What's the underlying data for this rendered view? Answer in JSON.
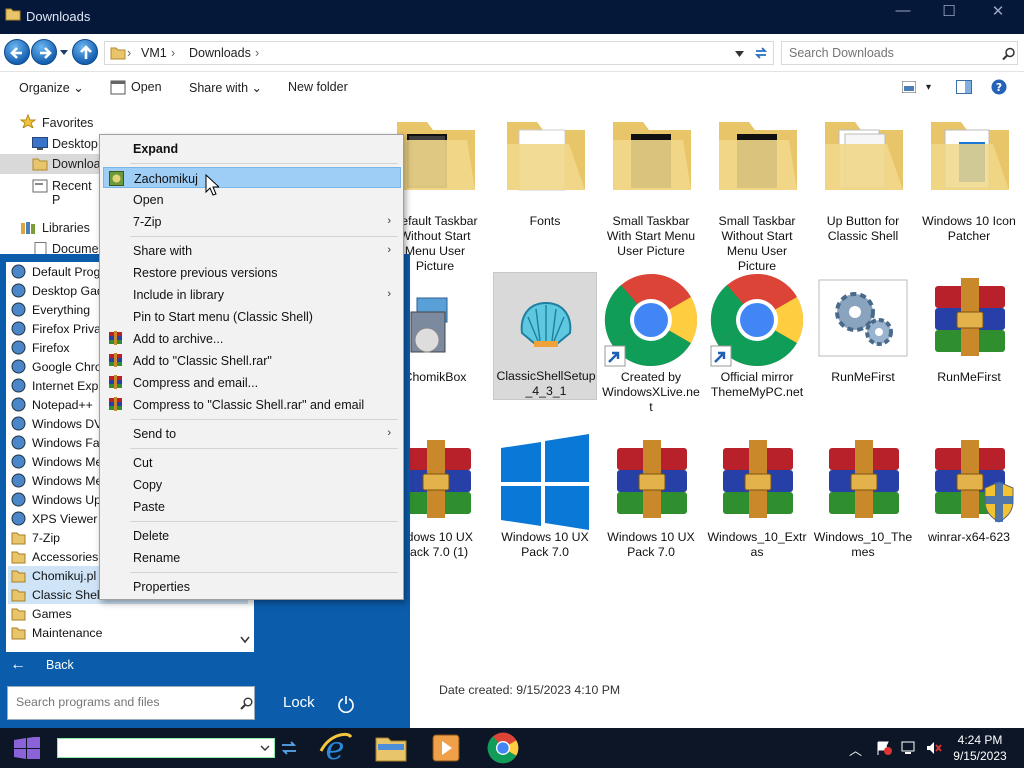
{
  "window": {
    "title": "Downloads",
    "controls": [
      "minimize",
      "maximize",
      "close"
    ]
  },
  "address": {
    "crumbs": [
      "VM1",
      "Downloads"
    ],
    "search_placeholder": "Search Downloads"
  },
  "toolbar": {
    "organize": "Organize",
    "open": "Open",
    "share_with": "Share with",
    "new_folder": "New folder"
  },
  "nav": {
    "favorites": "Favorites",
    "desktop": "Desktop",
    "downloads": "Downloa",
    "recent": "Recent P",
    "libraries": "Libraries",
    "documents": "Docume"
  },
  "files": {
    "row1": [
      {
        "label": "Default Taskbar\nWithout Start\nMenu User\nPicture",
        "icon": "folder-dark-icon"
      },
      {
        "label": "Fonts",
        "icon": "folder-doc-icon"
      },
      {
        "label": "Small Taskbar\nWith Start Menu\nUser Picture",
        "icon": "folder-dark-icon"
      },
      {
        "label": "Small Taskbar\nWithout Start\nMenu User\nPicture",
        "icon": "folder-dark-icon"
      },
      {
        "label": "Up Button for\nClassic Shell",
        "icon": "folder-stack-icon"
      },
      {
        "label": "Windows 10 Icon\nPatcher",
        "icon": "folder-blue-icon"
      }
    ],
    "row2": [
      {
        "label": "ChomikBox",
        "icon": "installer-icon"
      },
      {
        "label": "ClassicShellSetup\n_4_3_1",
        "icon": "shell-icon",
        "selected": true
      },
      {
        "label": "Created by\nWindowsXLive.ne\nt",
        "icon": "chrome-shortcut-icon"
      },
      {
        "label": "Official mirror\nThemeMyPC.net",
        "icon": "chrome-shortcut-icon"
      },
      {
        "label": "RunMeFirst",
        "icon": "gears-icon"
      },
      {
        "label": "RunMeFirst",
        "icon": "winrar-icon"
      }
    ],
    "row3": [
      {
        "label": "indows 10 UX\nPack 7.0 (1)",
        "icon": "winrar-icon"
      },
      {
        "label": "Windows 10 UX\nPack 7.0",
        "icon": "windows-logo-icon"
      },
      {
        "label": "Windows 10 UX\nPack 7.0",
        "icon": "winrar-icon"
      },
      {
        "label": "Windows_10_Extr\nas",
        "icon": "winrar-icon"
      },
      {
        "label": "Windows_10_The\nmes",
        "icon": "winrar-icon"
      },
      {
        "label": "winrar-x64-623",
        "icon": "winrar-shield-icon"
      }
    ]
  },
  "status": {
    "date_created": "Date created:  9/15/2023 4:10 PM"
  },
  "context_menu": [
    {
      "label": "Expand",
      "bold": true
    },
    {
      "sep": true
    },
    {
      "label": "Zachomikuj",
      "icon": "chomik-icon",
      "hover": true
    },
    {
      "label": "Open"
    },
    {
      "label": "7-Zip",
      "submenu": true
    },
    {
      "sep": true
    },
    {
      "label": "Share with",
      "submenu": true
    },
    {
      "label": "Restore previous versions"
    },
    {
      "label": "Include in library",
      "submenu": true
    },
    {
      "label": "Pin to Start menu (Classic Shell)"
    },
    {
      "label": "Add to archive...",
      "icon": "winrar-icon"
    },
    {
      "label": "Add to \"Classic Shell.rar\"",
      "icon": "winrar-icon"
    },
    {
      "label": "Compress and email...",
      "icon": "winrar-icon"
    },
    {
      "label": "Compress to \"Classic Shell.rar\" and email",
      "icon": "winrar-icon"
    },
    {
      "sep": true
    },
    {
      "label": "Send to",
      "submenu": true
    },
    {
      "sep": true
    },
    {
      "label": "Cut"
    },
    {
      "label": "Copy"
    },
    {
      "label": "Paste"
    },
    {
      "sep": true
    },
    {
      "label": "Delete"
    },
    {
      "label": "Rename"
    },
    {
      "sep": true
    },
    {
      "label": "Properties"
    }
  ],
  "start_menu": {
    "programs": [
      {
        "label": "Default Prog",
        "icon": "default-programs-icon"
      },
      {
        "label": "Desktop Gad",
        "icon": "gadgets-icon"
      },
      {
        "label": "Everything",
        "icon": "search-icon"
      },
      {
        "label": "Firefox Privat",
        "icon": "firefox-private-icon"
      },
      {
        "label": "Firefox",
        "icon": "firefox-icon"
      },
      {
        "label": "Google Chro",
        "icon": "chrome-icon"
      },
      {
        "label": "Internet Expl",
        "icon": "ie-icon"
      },
      {
        "label": "Notepad++",
        "icon": "notepadpp-icon"
      },
      {
        "label": "Windows DV",
        "icon": "dvd-icon"
      },
      {
        "label": "Windows Fax",
        "icon": "fax-icon"
      },
      {
        "label": "Windows Me",
        "icon": "media-center-icon"
      },
      {
        "label": "Windows Me",
        "icon": "media-player-icon"
      },
      {
        "label": "Windows Up",
        "icon": "update-icon"
      },
      {
        "label": "XPS Viewer",
        "icon": "xps-icon"
      },
      {
        "label": "7-Zip",
        "icon": "folder-icon"
      },
      {
        "label": "Accessories",
        "icon": "folder-icon"
      },
      {
        "label": "Chomikuj.pl",
        "icon": "folder-icon",
        "highlight": true
      },
      {
        "label": "Classic Shell",
        "icon": "folder-icon",
        "highlight": true
      },
      {
        "label": "Games",
        "icon": "folder-icon"
      },
      {
        "label": "Maintenance",
        "icon": "folder-icon"
      }
    ],
    "back": "Back",
    "search_placeholder": "Search programs and files",
    "lock": "Lock"
  },
  "taskbar": {
    "clock_time": "4:24 PM",
    "clock_date": "9/15/2023",
    "pinned": [
      "ie-icon",
      "explorer-icon",
      "media-player-icon",
      "chrome-icon"
    ]
  },
  "colors": {
    "accent": "#0b5cab",
    "titlebar": "#05183a",
    "menu_hover": "#9ecef6",
    "taskbar": "#0c1627"
  }
}
